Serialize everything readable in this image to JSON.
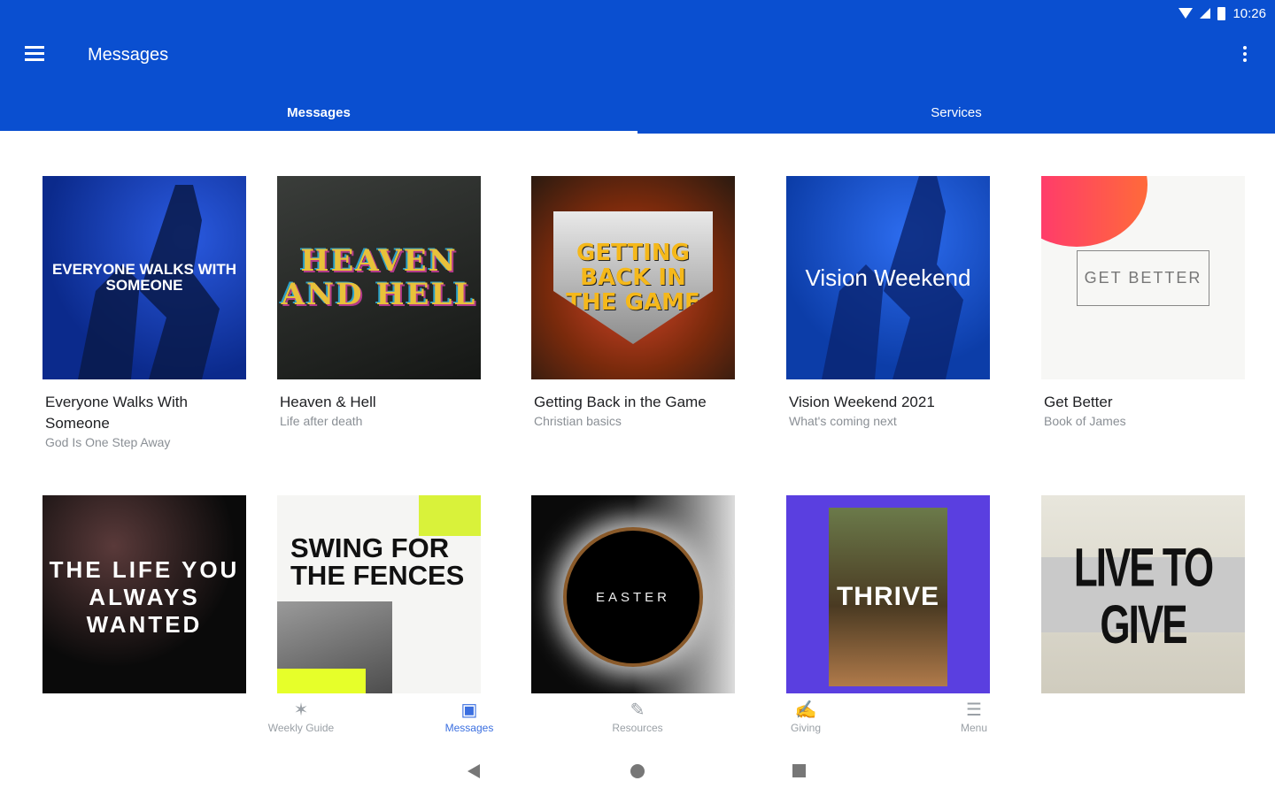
{
  "status": {
    "time": "10:26"
  },
  "appbar": {
    "title": "Messages",
    "menu_icon": "hamburger-menu-icon",
    "overflow_icon": "more-vert-icon"
  },
  "tabs": [
    {
      "label": "Messages",
      "active": true
    },
    {
      "label": "Services",
      "active": false
    }
  ],
  "cards": [
    {
      "art_text": "EVERYONE WALKS WITH SOMEONE",
      "title": "Everyone Walks With Someone",
      "subtitle": "God Is One Step Away"
    },
    {
      "art_text": "HEAVEN AND HELL",
      "title": "Heaven & Hell",
      "subtitle": "Life after death"
    },
    {
      "art_text": "GETTING BACK IN THE GAME",
      "title": "Getting Back in the Game",
      "subtitle": "Christian basics"
    },
    {
      "art_text": "Vision Weekend",
      "title": "Vision Weekend 2021",
      "subtitle": "What's coming next"
    },
    {
      "art_text": "GET BETTER",
      "title": "Get Better",
      "subtitle": "Book of James"
    },
    {
      "art_text": "THE LIFE YOU ALWAYS WANTED",
      "title": "",
      "subtitle": ""
    },
    {
      "art_text": "SWING FOR THE FENCES",
      "title": "",
      "subtitle": ""
    },
    {
      "art_text": "EASTER",
      "title": "",
      "subtitle": ""
    },
    {
      "art_text": "THRIVE",
      "title": "",
      "subtitle": ""
    },
    {
      "art_text": "LIVE TO GIVE",
      "title": "",
      "subtitle": ""
    }
  ],
  "bottom_nav": [
    {
      "label": "Weekly Guide",
      "icon": "sparkle-icon",
      "active": false
    },
    {
      "label": "Messages",
      "icon": "messages-icon",
      "active": true
    },
    {
      "label": "Resources",
      "icon": "resources-icon",
      "active": false
    },
    {
      "label": "Giving",
      "icon": "giving-hand-icon",
      "active": false
    },
    {
      "label": "Menu",
      "icon": "list-menu-icon",
      "active": false
    }
  ],
  "colors": {
    "primary": "#0a4fd0",
    "active_nav": "#3b6fe0"
  }
}
